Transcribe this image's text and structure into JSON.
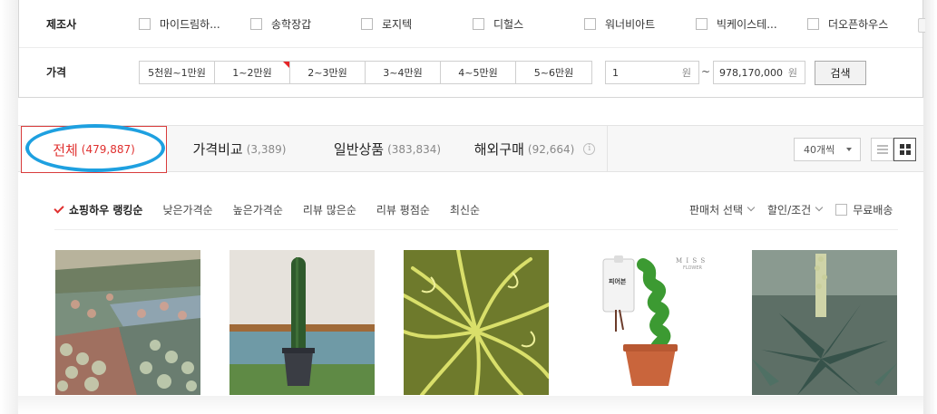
{
  "filters": {
    "maker_label": "제조사",
    "makers": [
      "마이드림하...",
      "송학장갑",
      "로지텍",
      "디헐스",
      "워너비아트",
      "빅케이스테...",
      "더오픈하우스"
    ],
    "price_label": "가격",
    "price_ranges": [
      "5천원~1만원",
      "1~2만원",
      "2~3만원",
      "3~4만원",
      "4~5만원",
      "5~6만원"
    ],
    "price_min": "1",
    "price_max": "978,170,000",
    "unit": "원",
    "tilde": "~",
    "search_label": "검색"
  },
  "tabs": [
    {
      "label": "전체",
      "count": "(479,887)"
    },
    {
      "label": "가격비교",
      "count": "(3,389)"
    },
    {
      "label": "일반상품",
      "count": "(383,834)"
    },
    {
      "label": "해외구매",
      "count": "(92,664)"
    }
  ],
  "info_icon_glyph": "i",
  "per_page": "40개씩",
  "sort": {
    "active": "쇼핑하우 랭킹순",
    "options": [
      "낮은가격순",
      "높은가격순",
      "리뷰 많은순",
      "리뷰 평점순",
      "최신순"
    ],
    "seller_select": "판매처 선택",
    "discount": "할인/조건",
    "free_shipping": "무료배송"
  },
  "accent_color": "#e0302f",
  "highlight_color": "#1ea0e0",
  "product_tag": {
    "brand": "M I S S",
    "brand_sub": "FLOWER",
    "name": "피어븐"
  }
}
